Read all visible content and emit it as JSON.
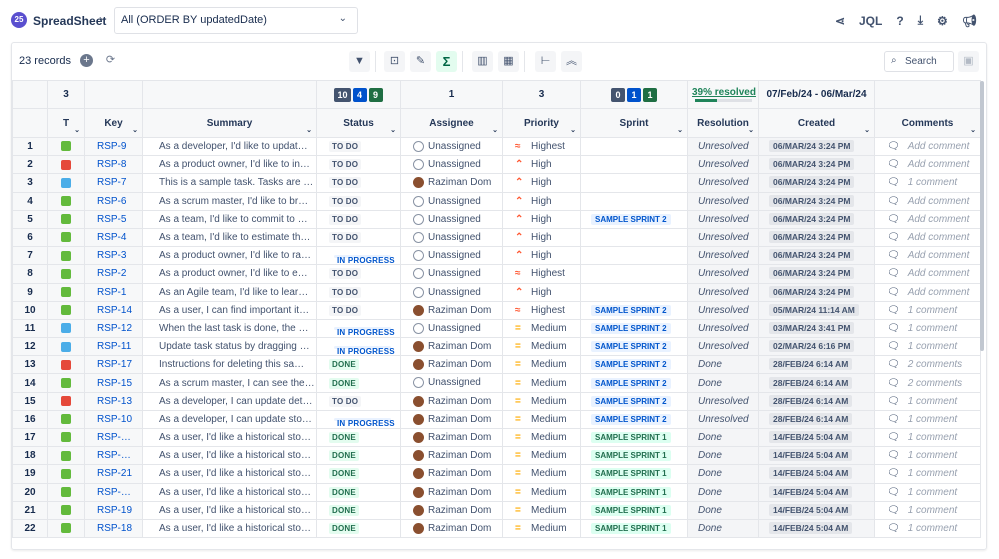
{
  "app": {
    "title": "SpreadSheet",
    "crumb_sep": "›",
    "filter": "All (ORDER BY updatedDate)",
    "jql": "JQL"
  },
  "toolbar": {
    "records": "23 records",
    "search_placeholder": "Search"
  },
  "summary": {
    "type_count": "3",
    "status_counts": [
      {
        "v": "10",
        "c": "#44546f"
      },
      {
        "v": "4",
        "c": "#0052cc"
      },
      {
        "v": "9",
        "c": "#1f6e43"
      }
    ],
    "assignee_count": "1",
    "priority_count": "3",
    "sprint_counts": [
      {
        "v": "0",
        "c": "#44546f"
      },
      {
        "v": "1",
        "c": "#0052cc"
      },
      {
        "v": "1",
        "c": "#1f6e43"
      }
    ],
    "resolved": "39% resolved",
    "resolved_pct": 39,
    "created_range": "07/Feb/24 - 06/Mar/24"
  },
  "columns": [
    "",
    "T",
    "Key",
    "Summary",
    "Status",
    "Assignee",
    "Priority",
    "Sprint",
    "Resolution",
    "Created",
    "Comments"
  ],
  "rows": [
    [
      "1",
      "story",
      "RSP-9",
      "As a developer, I'd like to updat…",
      "TO DO",
      "Unassigned",
      "Highest",
      "",
      "Unresolved",
      "06/MAR/24 3:24 PM",
      "Add comment"
    ],
    [
      "2",
      "bug",
      "RSP-8",
      "As a product owner, I'd like to in…",
      "TO DO",
      "Unassigned",
      "High",
      "",
      "Unresolved",
      "06/MAR/24 3:24 PM",
      "Add comment"
    ],
    [
      "3",
      "task",
      "RSP-7",
      "This is a sample task. Tasks are …",
      "TO DO",
      "Raziman Dom",
      "High",
      "",
      "Unresolved",
      "06/MAR/24 3:24 PM",
      "1 comment"
    ],
    [
      "4",
      "story",
      "RSP-6",
      "As a scrum master, I'd like to br…",
      "TO DO",
      "Unassigned",
      "High",
      "",
      "Unresolved",
      "06/MAR/24 3:24 PM",
      "Add comment"
    ],
    [
      "5",
      "story",
      "RSP-5",
      "As a team, I'd like to commit to …",
      "TO DO",
      "Unassigned",
      "High",
      "SAMPLE SPRINT 2",
      "Unresolved",
      "06/MAR/24 3:24 PM",
      "Add comment"
    ],
    [
      "6",
      "story",
      "RSP-4",
      "As a team, I'd like to estimate th…",
      "TO DO",
      "Unassigned",
      "High",
      "",
      "Unresolved",
      "06/MAR/24 3:24 PM",
      "Add comment"
    ],
    [
      "7",
      "story",
      "RSP-3",
      "As a product owner, I'd like to ra…",
      "IN PROGRESS",
      "Unassigned",
      "High",
      "",
      "Unresolved",
      "06/MAR/24 3:24 PM",
      "Add comment"
    ],
    [
      "8",
      "story",
      "RSP-2",
      "As a product owner, I'd like to e…",
      "TO DO",
      "Unassigned",
      "Highest",
      "",
      "Unresolved",
      "06/MAR/24 3:24 PM",
      "Add comment"
    ],
    [
      "9",
      "story",
      "RSP-1",
      "As an Agile team, I'd like to lear…",
      "TO DO",
      "Unassigned",
      "High",
      "",
      "Unresolved",
      "06/MAR/24 3:24 PM",
      "Add comment"
    ],
    [
      "10",
      "story",
      "RSP-14",
      "As a user, I can find important it…",
      "TO DO",
      "Raziman Dom",
      "Highest",
      "SAMPLE SPRINT 2",
      "Unresolved",
      "05/MAR/24 11:14 AM",
      "1 comment"
    ],
    [
      "11",
      "task",
      "RSP-12",
      "When the last task is done, the …",
      "IN PROGRESS",
      "Unassigned",
      "Medium",
      "SAMPLE SPRINT 2",
      "Unresolved",
      "03/MAR/24 3:41 PM",
      "1 comment"
    ],
    [
      "12",
      "task",
      "RSP-11",
      "Update task status by dragging …",
      "IN PROGRESS",
      "Raziman Dom",
      "Medium",
      "SAMPLE SPRINT 2",
      "Unresolved",
      "02/MAR/24 6:16 PM",
      "1 comment"
    ],
    [
      "13",
      "bug",
      "RSP-17",
      "Instructions for deleting this sa…",
      "DONE",
      "Raziman Dom",
      "Medium",
      "SAMPLE SPRINT 2",
      "Done",
      "28/FEB/24 6:14 AM",
      "2 comments"
    ],
    [
      "14",
      "story",
      "RSP-15",
      "As a scrum master, I can see the…",
      "DONE",
      "Unassigned",
      "Medium",
      "SAMPLE SPRINT 2",
      "Done",
      "28/FEB/24 6:14 AM",
      "2 comments"
    ],
    [
      "15",
      "bug",
      "RSP-13",
      "As a developer, I can update det…",
      "TO DO",
      "Raziman Dom",
      "Medium",
      "SAMPLE SPRINT 2",
      "Unresolved",
      "28/FEB/24 6:14 AM",
      "1 comment"
    ],
    [
      "16",
      "story",
      "RSP-10",
      "As a developer, I can update sto…",
      "IN PROGRESS",
      "Raziman Dom",
      "Medium",
      "SAMPLE SPRINT 2",
      "Unresolved",
      "28/FEB/24 6:14 AM",
      "1 comment"
    ],
    [
      "17",
      "story",
      "RSP-…",
      "As a user, I'd like a historical sto…",
      "DONE",
      "Raziman Dom",
      "Medium",
      "SAMPLE SPRINT 1",
      "Done",
      "14/FEB/24 5:04 AM",
      "1 comment"
    ],
    [
      "18",
      "story",
      "RSP-…",
      "As a user, I'd like a historical sto…",
      "DONE",
      "Raziman Dom",
      "Medium",
      "SAMPLE SPRINT 1",
      "Done",
      "14/FEB/24 5:04 AM",
      "1 comment"
    ],
    [
      "19",
      "story",
      "RSP-21",
      "As a user, I'd like a historical sto…",
      "DONE",
      "Raziman Dom",
      "Medium",
      "SAMPLE SPRINT 1",
      "Done",
      "14/FEB/24 5:04 AM",
      "1 comment"
    ],
    [
      "20",
      "story",
      "RSP-…",
      "As a user, I'd like a historical sto…",
      "DONE",
      "Raziman Dom",
      "Medium",
      "SAMPLE SPRINT 1",
      "Done",
      "14/FEB/24 5:04 AM",
      "1 comment"
    ],
    [
      "21",
      "story",
      "RSP-19",
      "As a user, I'd like a historical sto…",
      "DONE",
      "Raziman Dom",
      "Medium",
      "SAMPLE SPRINT 1",
      "Done",
      "14/FEB/24 5:04 AM",
      "1 comment"
    ],
    [
      "22",
      "story",
      "RSP-18",
      "As a user, I'd like a historical sto…",
      "DONE",
      "Raziman Dom",
      "Medium",
      "SAMPLE SPRINT 1",
      "Done",
      "14/FEB/24 5:04 AM",
      "1 comment"
    ]
  ],
  "colors": {
    "story": "#63ba3c",
    "bug": "#e5493a",
    "task": "#4bade8",
    "priority_high": "#ff5630",
    "priority_medium": "#ffab00"
  }
}
